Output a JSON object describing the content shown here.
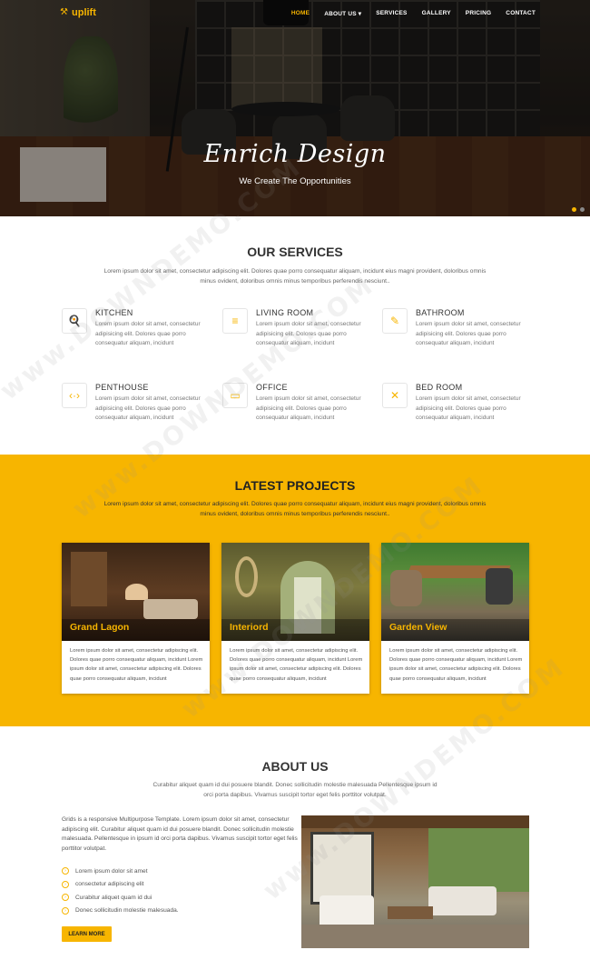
{
  "nav": {
    "logo": "uplift",
    "items": [
      {
        "label": "HOME",
        "active": true
      },
      {
        "label": "ABOUT US ▾",
        "active": false
      },
      {
        "label": "SERVICES",
        "active": false
      },
      {
        "label": "GALLERY",
        "active": false
      },
      {
        "label": "PRICING",
        "active": false
      },
      {
        "label": "CONTACT",
        "active": false
      }
    ]
  },
  "hero": {
    "title": "Enrich Design",
    "subtitle": "We Create The Opportunities",
    "slides_total": 2,
    "active_slide": 1
  },
  "services": {
    "title": "OUR SERVICES",
    "description": "Lorem ipsum dolor sit amet, consectetur adipiscing elit. Dolores quae porro consequatur aliquam, incidunt eius magni provident, doloribus omnis minus ovident, doloribus omnis minus temporibus perferendis nesciunt..",
    "items": [
      {
        "name": "KITCHEN",
        "icon": "kitchen-icon",
        "glyph": "🍳",
        "text": "Lorem ipsum dolor sit amet, consectetur adipisicing elit. Dolores quae porro consequatur aliquam, incidunt"
      },
      {
        "name": "LIVING ROOM",
        "icon": "sofa-icon",
        "glyph": "≡",
        "text": "Lorem ipsum dolor sit amet, consectetur adipisicing elit. Dolores quae porro consequatur aliquam, incidunt"
      },
      {
        "name": "BATHROOM",
        "icon": "edit-icon",
        "glyph": "✎",
        "text": "Lorem ipsum dolor sit amet, consectetur adipisicing elit. Dolores quae porro consequatur aliquam, incidunt"
      },
      {
        "name": "PENTHOUSE",
        "icon": "code-icon",
        "glyph": "‹·›",
        "text": "Lorem ipsum dolor sit amet, consectetur adipisicing elit. Dolores quae porro consequatur aliquam, incidunt"
      },
      {
        "name": "OFFICE",
        "icon": "browser-icon",
        "glyph": "▭",
        "text": "Lorem ipsum dolor sit amet, consectetur adipisicing elit. Dolores quae porro consequatur aliquam, incidunt"
      },
      {
        "name": "BED ROOM",
        "icon": "tools-icon",
        "glyph": "✕",
        "text": "Lorem ipsum dolor sit amet, consectetur adipisicing elit. Dolores quae porro consequatur aliquam, incidunt"
      }
    ]
  },
  "projects": {
    "title": "LATEST PROJECTS",
    "description": "Lorem ipsum dolor sit amet, consectetur adipiscing elit. Dolores quae porro consequatur aliquam, incidunt eius magni provident, doloribus omnis minus ovident, doloribus omnis minus temporibus perferendis nesciunt..",
    "cards": [
      {
        "name": "Grand Lagon",
        "text": "Lorem ipsum dolor sit amet, consectetur adipiscing elit. Dolores quae porro consequatur aliquam, incidunt Lorem ipsum dolor sit amet, consectetur adipiscing elit. Dolores quae porro consequatur aliquam, incidunt"
      },
      {
        "name": "Interiord",
        "text": "Lorem ipsum dolor sit amet, consectetur adipiscing elit. Dolores quae porro consequatur aliquam, incidunt Lorem ipsum dolor sit amet, consectetur adipiscing elit. Dolores quae porro consequatur aliquam, incidunt"
      },
      {
        "name": "Garden View",
        "text": "Lorem ipsum dolor sit amet, consectetur adipiscing elit. Dolores quae porro consequatur aliquam, incidunt Lorem ipsum dolor sit amet, consectetur adipiscing elit. Dolores quae porro consequatur aliquam, incidunt"
      }
    ]
  },
  "about": {
    "title": "ABOUT US",
    "description": "Curabitur aliquet quam id dui posuere blandit. Donec sollicitudin molestie malesuada Pellentesque ipsum id orci porta dapibus. Vivamus suscipit tortor eget felis porttitor volutpat.",
    "body": "Grids is a responsive Multipurpose Template. Lorem ipsum dolor sit amet, consectetur adipiscing elit. Curabitur aliquet quam id dui posuere blandit. Donec sollicitudin molestie malesuada. Pellentesque in ipsum id orci porta dapibus. Vivamus suscipit tortor eget felis porttitor volutpat.",
    "bullets": [
      "Lorem ipsum dolor sit amet",
      "consectetur adipiscing elit",
      "Curabitur aliquet quam id dui",
      "Donec sollicitudin molestie malesuada."
    ],
    "button_label": "LEARN MORE"
  },
  "colors": {
    "accent": "#f7b500",
    "text": "#333333"
  }
}
